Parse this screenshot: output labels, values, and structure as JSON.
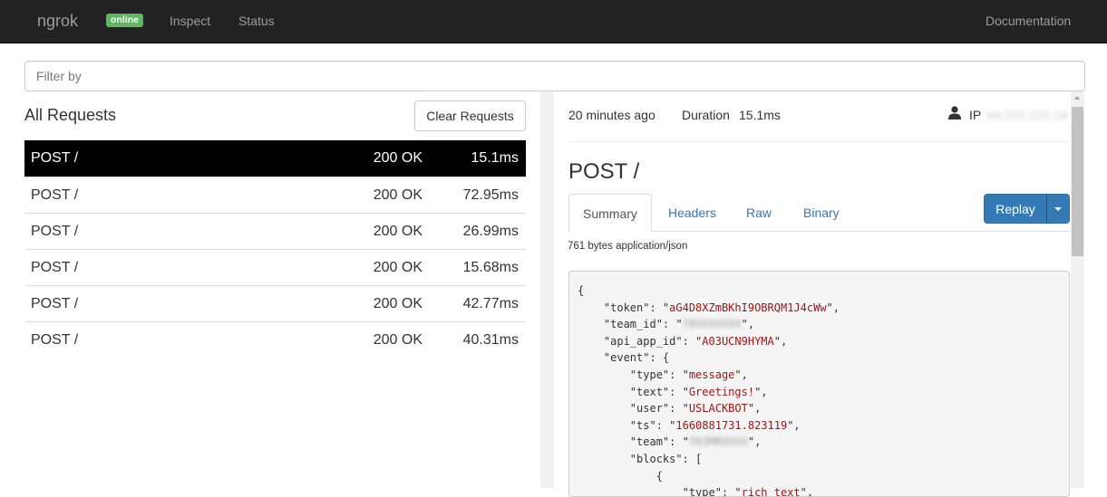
{
  "navbar": {
    "brand": "ngrok",
    "status_badge": "online",
    "links": {
      "inspect": "Inspect",
      "status": "Status",
      "documentation": "Documentation"
    }
  },
  "filter": {
    "placeholder": "Filter by",
    "value": ""
  },
  "requests_panel": {
    "title": "All Requests",
    "clear_button": "Clear Requests",
    "rows": [
      {
        "method": "POST /",
        "status": "200 OK",
        "duration": "15.1ms",
        "selected": true
      },
      {
        "method": "POST /",
        "status": "200 OK",
        "duration": "72.95ms",
        "selected": false
      },
      {
        "method": "POST /",
        "status": "200 OK",
        "duration": "26.99ms",
        "selected": false
      },
      {
        "method": "POST /",
        "status": "200 OK",
        "duration": "15.68ms",
        "selected": false
      },
      {
        "method": "POST /",
        "status": "200 OK",
        "duration": "42.77ms",
        "selected": false
      },
      {
        "method": "POST /",
        "status": "200 OK",
        "duration": "40.31ms",
        "selected": false
      }
    ]
  },
  "detail": {
    "time_ago": "20 minutes ago",
    "duration_label": "Duration",
    "duration_value": "15.1ms",
    "ip_label": "IP",
    "ip_value": "44.200.220.24",
    "title": "POST /",
    "tabs": {
      "summary": "Summary",
      "headers": "Headers",
      "raw": "Raw",
      "binary": "Binary"
    },
    "active_tab": "summary",
    "replay_button": "Replay",
    "body_info": "761 bytes application/json",
    "json_body": {
      "token": "aG4D8XZmBKhI9OBRQM1J4cWw",
      "team_id": "T0XXXXXXX",
      "api_app_id": "A03UCN9HYMA",
      "event_type": "message",
      "event_text": "Greetings!",
      "event_user": "USLACKBOT",
      "event_ts": "1660881731.823119",
      "event_team": "T03MRXXXX",
      "block_type_hint": "rich_text"
    }
  },
  "colors": {
    "navbar_bg": "#222222",
    "online_badge": "#5cb85c",
    "link": "#337ab7",
    "selected_row_bg": "#000000",
    "json_string": "#a31515"
  }
}
